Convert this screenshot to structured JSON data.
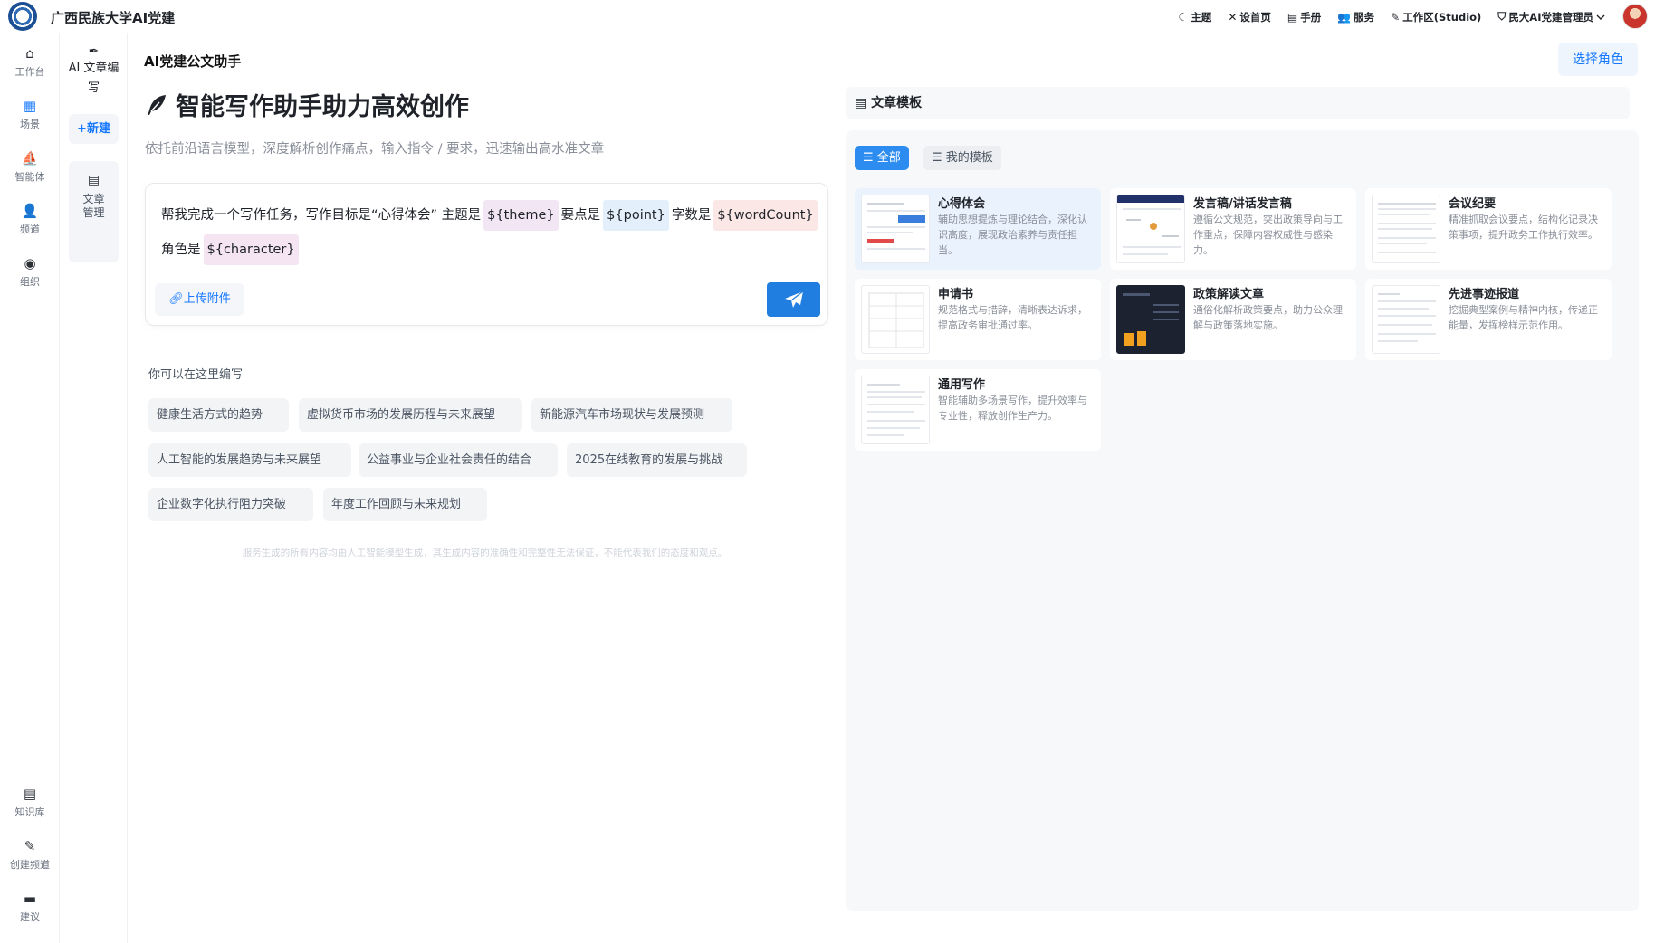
{
  "app": {
    "title": "广西民族大学AI党建"
  },
  "topnav": [
    {
      "icon": "moon-icon",
      "glyph": "☾",
      "label": "主题"
    },
    {
      "icon": "tools-icon",
      "glyph": "✕",
      "label": "设首页"
    },
    {
      "icon": "book-icon",
      "glyph": "▤",
      "label": "手册"
    },
    {
      "icon": "users-icon",
      "glyph": "👥",
      "label": "服务"
    },
    {
      "icon": "pen-icon",
      "glyph": "✎",
      "label": "工作区(Studio)"
    },
    {
      "icon": "shield-icon",
      "glyph": "⛉",
      "label": "民大AI党建管理员",
      "dropdown": true
    }
  ],
  "rail": {
    "top": [
      {
        "name": "home",
        "glyph": "⌂",
        "label": "工作台"
      },
      {
        "name": "scene",
        "glyph": "▦",
        "label": "场景"
      },
      {
        "name": "agent",
        "glyph": "⛵",
        "label": "智能体"
      },
      {
        "name": "channel",
        "glyph": "👤",
        "label": "频道"
      },
      {
        "name": "org",
        "glyph": "◉",
        "label": "组织"
      }
    ],
    "bottom": [
      {
        "name": "knowledge",
        "glyph": "▤",
        "label": "知识库"
      },
      {
        "name": "create-channel",
        "glyph": "✎",
        "label": "创建频道"
      },
      {
        "name": "suggestion",
        "glyph": "▬",
        "label": "建议"
      }
    ]
  },
  "subbar": {
    "ai_label": "AI 文章编写",
    "new_label": "+新建",
    "doc_label": "文章管理"
  },
  "main": {
    "title": "AI党建公文助手",
    "role_button": "选择角色",
    "hero": "智能写作助手助力高效创作",
    "subtitle": "依托前沿语言模型，深度解析创作痛点，输入指令 / 要求，迅速输出高水准文章",
    "prompt": {
      "p1": "帮我完成一个写作任务，写作目标是“心得体会” 主题是",
      "theme": "${theme}",
      "p2": "要点是",
      "point": "${point}",
      "p3": "字数是",
      "word": "${wordCount}",
      "p4": "角色是",
      "char": "${character}"
    },
    "upload_label": "上传附件",
    "suggest_title": "你可以在这里编写",
    "suggestions": [
      "健康生活方式的趋势",
      "虚拟货币市场的发展历程与未来展望",
      "新能源汽车市场现状与发展预测",
      "人工智能的发展趋势与未来展望",
      "公益事业与企业社会责任的结合",
      "2025在线教育的发展与挑战",
      "企业数字化执行阻力突破",
      "年度工作回顾与未来规划"
    ],
    "disclaimer": "服务生成的所有内容均由人工智能模型生成，其生成内容的准确性和完整性无法保证，不能代表我们的态度和观点。"
  },
  "templates": {
    "header": "文章模板",
    "filters": {
      "all": "全部",
      "mine": "我的模板"
    },
    "cards": [
      {
        "title": "心得体会",
        "desc": "辅助思想提炼与理论结合，深化认识高度，展现政治素养与责任担当。"
      },
      {
        "title": "发言稿/讲话发言稿",
        "desc": "遵循公文规范，突出政策导向与工作重点，保障内容权威性与感染力。"
      },
      {
        "title": "会议纪要",
        "desc": "精准抓取会议要点，结构化记录决策事项，提升政务工作执行效率。"
      },
      {
        "title": "申请书",
        "desc": "规范格式与措辞，清晰表达诉求，提高政务审批通过率。"
      },
      {
        "title": "政策解读文章",
        "desc": "通俗化解析政策要点，助力公众理解与政策落地实施。"
      },
      {
        "title": "先进事迹报道",
        "desc": "挖掘典型案例与精神内核，传递正能量，发挥榜样示范作用。"
      },
      {
        "title": "通用写作",
        "desc": "智能辅助多场景写作，提升效率与专业性，释放创作生产力。"
      }
    ]
  },
  "colors": {
    "accent": "#1677ff",
    "send": "#1f7ee0",
    "active_card": "#e9f2fd"
  }
}
